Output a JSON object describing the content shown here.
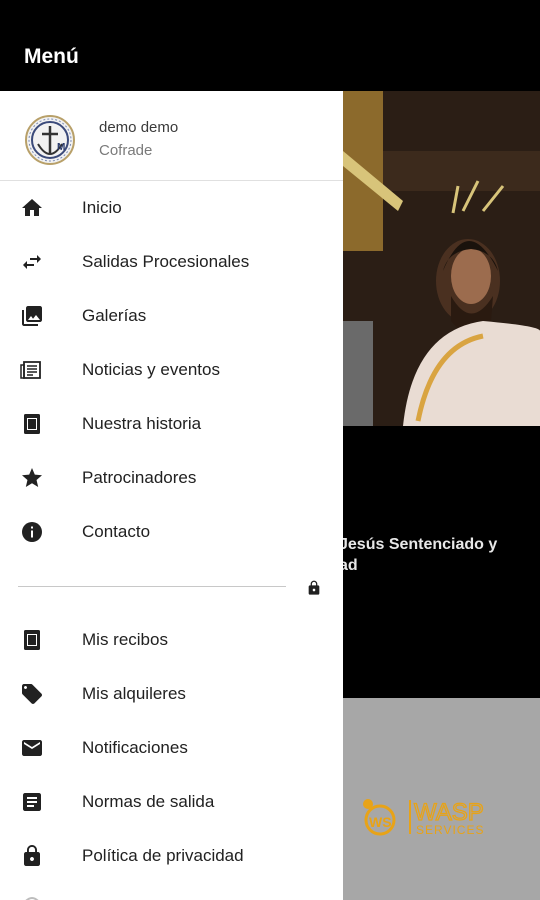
{
  "appbar": {
    "title": "Menú"
  },
  "user": {
    "name": "demo demo",
    "role": "Cofrade"
  },
  "menu": {
    "main": [
      {
        "label": "Inicio",
        "icon": "home-icon"
      },
      {
        "label": "Salidas Procesionales",
        "icon": "swap-arrows-icon"
      },
      {
        "label": "Galerías",
        "icon": "gallery-icon"
      },
      {
        "label": "Noticias y eventos",
        "icon": "newspaper-icon"
      },
      {
        "label": "Nuestra historia",
        "icon": "book-icon"
      },
      {
        "label": "Patrocinadores",
        "icon": "star-icon"
      },
      {
        "label": "Contacto",
        "icon": "info-icon"
      }
    ],
    "private": [
      {
        "label": "Mis recibos",
        "icon": "receipt-icon"
      },
      {
        "label": "Mis alquileres",
        "icon": "tag-icon"
      },
      {
        "label": "Notificaciones",
        "icon": "mail-icon"
      },
      {
        "label": "Normas de salida",
        "icon": "document-icon"
      },
      {
        "label": "Política de privacidad",
        "icon": "lock-icon"
      }
    ]
  },
  "background": {
    "caption_line1": "Jesús Sentenciado y",
    "caption_line2": "ad",
    "sponsor_logo": {
      "text": "WASP",
      "subtext": "SERVICES",
      "mark": "WS"
    }
  },
  "colors": {
    "appbar": "#000000",
    "drawer": "#ffffff",
    "icon": "#212121",
    "sponsor_bg": "#a7a7a7",
    "logo_yellow": "#e8a317"
  }
}
